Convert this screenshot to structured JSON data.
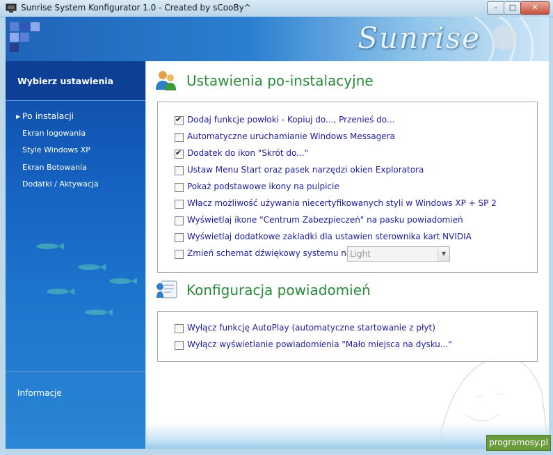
{
  "window": {
    "title": "Sunrise System Konfigurator 1.0 - Created by sCooBy^",
    "controls": {
      "minimize": "–",
      "maximize": "□",
      "close": "✕"
    }
  },
  "banner": {
    "brand": "Sunrise",
    "logo_colors": [
      "#5a7fd6",
      "#3355b5",
      "#8fa8e8",
      "#2a3f8c"
    ]
  },
  "sidebar": {
    "header": "Wybierz ustawienia",
    "items": [
      {
        "label": "Po instalacji",
        "active": true
      },
      {
        "label": "Ekran logowania"
      },
      {
        "label": "Style Windows XP"
      },
      {
        "label": "Ekran Botowania"
      },
      {
        "label": "Dodatki / Aktywacja"
      }
    ],
    "info": "Informacje"
  },
  "sections": {
    "post_install": {
      "title": "Ustawienia po-instalacyjne",
      "options": [
        {
          "label": "Dodaj funkcje powłoki - Kopiuj do..., Przenieś do...",
          "checked": true
        },
        {
          "label": "Automatyczne uruchamianie Windows Messagera",
          "checked": false
        },
        {
          "label": "Dodatek do ikon \"Skrót do...\"",
          "checked": true
        },
        {
          "label": "Ustaw Menu Start oraz pasek narzędzi okien Exploratora",
          "checked": false
        },
        {
          "label": "Pokaż podstawowe ikony na pulpicie",
          "checked": false
        },
        {
          "label": "Włacz możliwość używania niecertyfikowanych styli w Windows XP + SP 2",
          "checked": false
        },
        {
          "label": "Wyświetlaj ikone \"Centrum  Zabezpieczeń\" na pasku powiadomień",
          "checked": false
        },
        {
          "label": "Wyświetlaj dodatkowe zakladki dla ustawien sterownika kart NVIDIA",
          "checked": false
        },
        {
          "label": "Zmień schemat dźwiękowy systemu na :",
          "checked": false
        }
      ],
      "sound_scheme": {
        "value": "Light"
      }
    },
    "notifications": {
      "title": "Konfiguracja powiadomień",
      "options": [
        {
          "label": "Wyłącz funkcję AutoPlay (automatyczne startowanie z płyt)",
          "checked": false
        },
        {
          "label": "Wyłącz wyświetlanie powiadomienia \"Mało miejsca na dysku...\"",
          "checked": false
        }
      ]
    }
  },
  "watermark": "programosy.pl",
  "colors": {
    "section_title": "#2b8a3a",
    "option_text": "#1c1c9e",
    "sidebar_bg": "#1561c0"
  }
}
